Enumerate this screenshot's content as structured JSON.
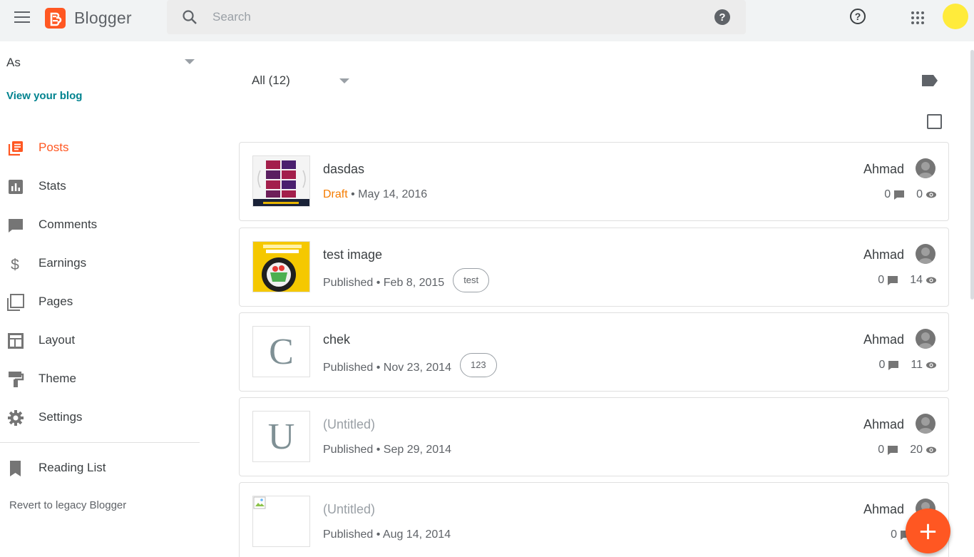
{
  "app": {
    "logo_text": "Blogger"
  },
  "search": {
    "placeholder": "Search"
  },
  "sidebar": {
    "blog_name": "As",
    "view_blog": "View your blog",
    "items": [
      {
        "label": "Posts",
        "icon": "posts-icon",
        "active": true
      },
      {
        "label": "Stats",
        "icon": "stats-icon"
      },
      {
        "label": "Comments",
        "icon": "comments-icon"
      },
      {
        "label": "Earnings",
        "icon": "earnings-icon"
      },
      {
        "label": "Pages",
        "icon": "pages-icon"
      },
      {
        "label": "Layout",
        "icon": "layout-icon"
      },
      {
        "label": "Theme",
        "icon": "theme-icon"
      },
      {
        "label": "Settings",
        "icon": "settings-icon"
      }
    ],
    "reading_list": "Reading List",
    "revert": "Revert to legacy Blogger"
  },
  "filter": {
    "label": "All (12)"
  },
  "posts": [
    {
      "title": "dasdas",
      "status": "Draft",
      "separator": " • ",
      "date": "May 14, 2016",
      "label": "",
      "author": "Ahmad",
      "comments": "0",
      "views": "0"
    },
    {
      "title": "test image",
      "status": "Published",
      "separator": " • ",
      "date": "Feb 8, 2015",
      "label": "test",
      "author": "Ahmad",
      "comments": "0",
      "views": "14"
    },
    {
      "title": "chek",
      "status": "Published",
      "separator": " • ",
      "date": "Nov 23, 2014",
      "label": "123",
      "author": "Ahmad",
      "comments": "0",
      "views": "11",
      "thumb_letter": "C"
    },
    {
      "title": "(Untitled)",
      "status": "Published",
      "separator": " • ",
      "date": "Sep 29, 2014",
      "label": "",
      "author": "Ahmad",
      "comments": "0",
      "views": "20",
      "thumb_letter": "U"
    },
    {
      "title": "(Untitled)",
      "status": "Published",
      "separator": " • ",
      "date": "Aug 14, 2014",
      "label": "",
      "author": "Ahmad",
      "comments": "0",
      "views": ""
    }
  ],
  "fab": {
    "symbol": "+"
  },
  "colors": {
    "accent": "#ff5722",
    "draft": "#f57c00",
    "link": "#00838f",
    "topbar": "#f1f3f4"
  }
}
